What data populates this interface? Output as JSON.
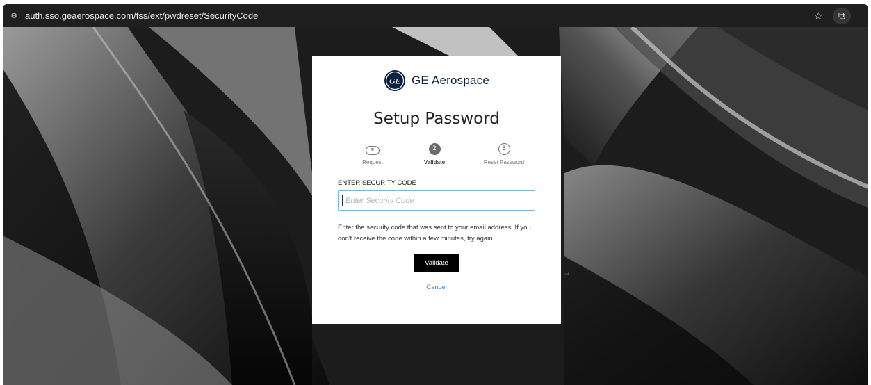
{
  "browser": {
    "url": "auth.sso.geaerospace.com/fss/ext/pwdreset/SecurityCode",
    "site_icon": "tune-icon",
    "bookmark_icon": "☆",
    "extension_icon": "⧉"
  },
  "card": {
    "brand_name": "GE Aerospace",
    "logo_text": "GE",
    "title": "Setup Password",
    "steps": [
      {
        "number": "1",
        "label": "Request",
        "state": "done"
      },
      {
        "number": "2",
        "label": "Validate",
        "state": "active"
      },
      {
        "number": "3",
        "label": "Reset Password",
        "state": "pending"
      }
    ],
    "field_label": "ENTER SECURITY CODE",
    "input": {
      "placeholder": "Enter Security Code",
      "value": ""
    },
    "help_text": "Enter the security code that was sent to your email address. If you don't receive the code within a few minutes, try again.",
    "validate_label": "Validate",
    "cancel_label": "Cancel"
  },
  "colors": {
    "primary_button": "#000000",
    "link": "#2a8bc4",
    "input_focus_border": "#7cb8d8",
    "brand_navy": "#0a2240"
  }
}
